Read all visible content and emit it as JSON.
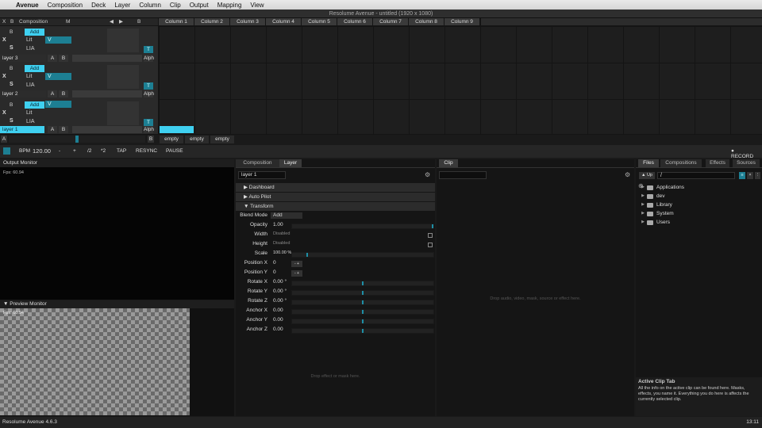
{
  "menubar": {
    "app": "Avenue",
    "items": [
      "Composition",
      "Deck",
      "Layer",
      "Column",
      "Clip",
      "Output",
      "Mapping",
      "View"
    ]
  },
  "window_title": "Resolume Avenue - untitled (1920 x 1080)",
  "header": {
    "x": "X",
    "b": "B",
    "s": "S",
    "composition": "Composition",
    "m": "M",
    "nav_prev": "◀",
    "nav_next": "▶",
    "nav_b": "B",
    "columns": [
      "Column 1",
      "Column 2",
      "Column 3",
      "Column 4",
      "Column 5",
      "Column 6",
      "Column 7",
      "Column 8",
      "Column 9"
    ]
  },
  "layers": [
    {
      "name": "layer 3",
      "blend": "Add",
      "lit": "Lit",
      "lia": "LIA",
      "a": "A",
      "b": "B",
      "alph": "Alph",
      "t": "T",
      "v": "V"
    },
    {
      "name": "layer 2",
      "blend": "Add",
      "lit": "Lit",
      "lia": "LIA",
      "a": "A",
      "b": "B",
      "alph": "Alph",
      "t": "T",
      "v": "V"
    },
    {
      "name": "layer 1",
      "blend": "Add",
      "lit": "Lit",
      "lia": "LIA",
      "a": "A",
      "b": "B",
      "alph": "Alph",
      "t": "T",
      "v": "V"
    }
  ],
  "crossfader": {
    "a": "A",
    "b": "B"
  },
  "empty_clips": [
    "empty",
    "empty",
    "empty"
  ],
  "transport": {
    "bpm_label": "BPM",
    "bpm": "120.00",
    "minus": "-",
    "plus": "+",
    "div2": "/2",
    "mul2": "*2",
    "tap": "TAP",
    "resync": "RESYNC",
    "pause": "PAUSE",
    "record": "● RECORD"
  },
  "output_monitor": {
    "title": "Output Monitor",
    "fps": "Fps: 60.94"
  },
  "preview_monitor": {
    "title": "▼ Preview Monitor",
    "fps": "Fps: 60.94"
  },
  "layer_panel": {
    "tabs": [
      "Composition",
      "Layer"
    ],
    "layer_name": "layer 1",
    "sections": [
      "▶ Dashboard",
      "▶ Auto Pilot",
      "▼ Transform"
    ],
    "blend_mode_label": "Blend Mode",
    "blend_mode": "Add",
    "params": [
      {
        "label": "Opacity",
        "value": "1.00",
        "fill": 1.0
      },
      {
        "label": "Width",
        "value": "Disabled",
        "check": true
      },
      {
        "label": "Height",
        "value": "Disabled",
        "check": true
      },
      {
        "label": "Scale",
        "value": "100.00 %",
        "fill": 0.1
      },
      {
        "label": "Position X",
        "value": "0",
        "pm": "- +"
      },
      {
        "label": "Position Y",
        "value": "0",
        "pm": "- +"
      },
      {
        "label": "Rotate X",
        "value": "0.00 °",
        "fill": 0.5
      },
      {
        "label": "Rotate Y",
        "value": "0.00 °",
        "fill": 0.5
      },
      {
        "label": "Rotate Z",
        "value": "0.00 °",
        "fill": 0.5
      },
      {
        "label": "Anchor X",
        "value": "0.00",
        "fill": 0.5
      },
      {
        "label": "Anchor Y",
        "value": "0.00",
        "fill": 0.5
      },
      {
        "label": "Anchor Z",
        "value": "0.00",
        "fill": 0.5
      }
    ],
    "drop_hint": "Drop effect or mask here."
  },
  "clip_panel": {
    "tab": "Clip",
    "drop_hint": "Drop audio, video, mask, source or effect here."
  },
  "files_panel": {
    "tabs": [
      "Files",
      "Compositions",
      "Effects",
      "Sources"
    ],
    "up": "▲ Up",
    "path": "/",
    "folders": [
      "Applications",
      "dev",
      "Library",
      "System",
      "Users"
    ],
    "info_title": "Active Clip Tab",
    "info_text": "All the info on the active clip can be found here. Masks, effects, you name it. Everything you do here is affects the currently selected clip."
  },
  "status": {
    "version": "Resolume Avenue 4.6.3",
    "time": "13:11"
  }
}
